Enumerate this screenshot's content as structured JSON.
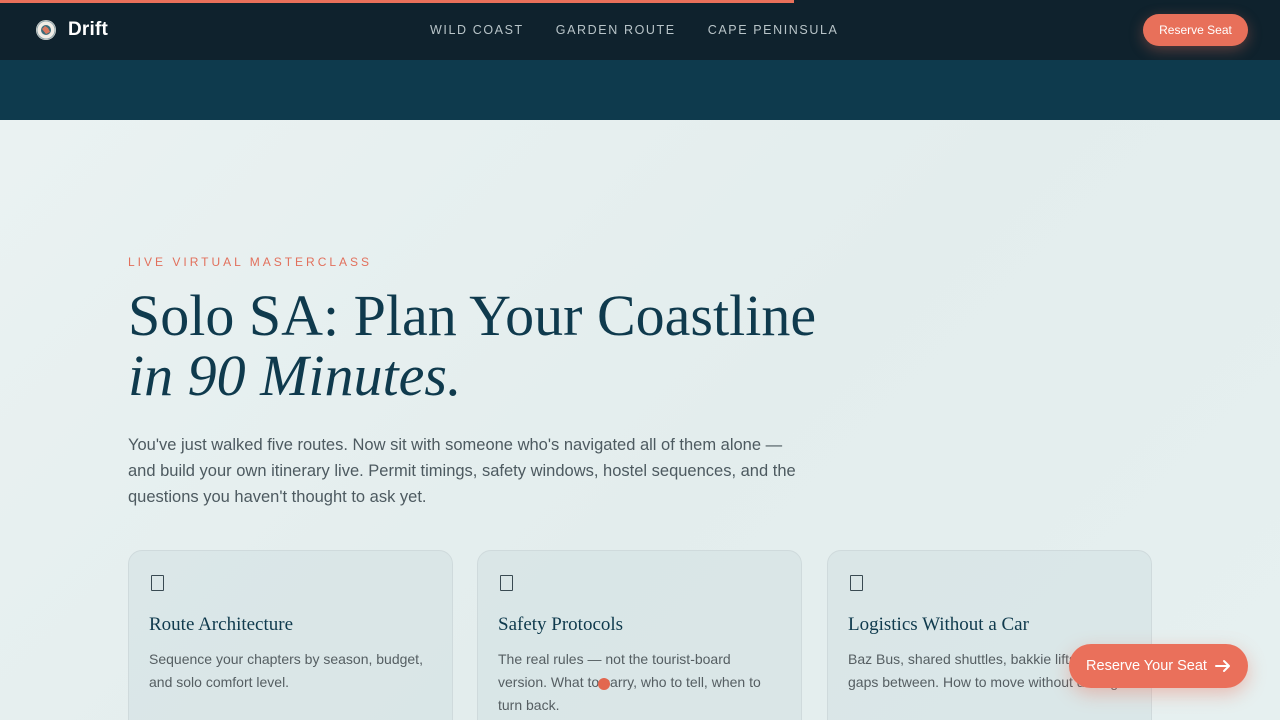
{
  "progress": {
    "value": 0.62
  },
  "nav": {
    "brand": "Drift",
    "links": [
      "WILD COAST",
      "GARDEN ROUTE",
      "CAPE PENINSULA"
    ],
    "cta": "Reserve Seat"
  },
  "hero": {
    "eyebrow": "LIVE VIRTUAL MASTERCLASS",
    "title_line1": "Solo SA: Plan Your Coastline",
    "title_line2": "in 90 Minutes.",
    "lead": "You've just walked five routes. Now sit with someone who's navigated all of them alone — and build your own itinerary live. Permit timings, safety windows, hostel sequences, and the questions you haven't thought to ask yet."
  },
  "cards": [
    {
      "icon": "document-icon",
      "title": "Route Architecture",
      "body": "Sequence your chapters by season, budget, and solo comfort level."
    },
    {
      "icon": "document-icon",
      "title": "Safety Protocols",
      "body": "The real rules — not the tourist-board version. What to carry, who to tell, when to turn back."
    },
    {
      "icon": "document-icon",
      "title": "Logistics Without a Car",
      "body": "Baz Bus, shared shuttles, bakkie lifts and the gaps between. How to move without driving."
    }
  ],
  "float_cta": {
    "label": "Reserve Your Seat"
  },
  "colors": {
    "accent": "#e8705a",
    "nav_bg": "#0f222d",
    "band_bg": "#0e3a4d",
    "title": "#0f3a4d"
  }
}
